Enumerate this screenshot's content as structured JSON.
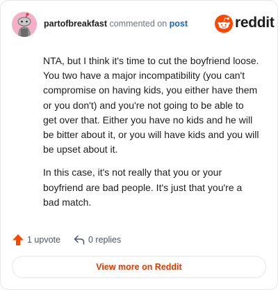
{
  "comment": {
    "author": "partofbreakfast",
    "verb": "commented on",
    "post_link": "post",
    "paragraphs": [
      "NTA, but I think it's time to cut the boyfriend loose. You two have a major incompatibility (you can't compromise on having kids, you either have them or you don't) and you're not going to be able to get over that. Either you have no kids and he will be bitter about it, or you will have kids and you will be upset about it.",
      "In this case, it's not really that you or your boyfriend are bad people. It's just that you're a bad match."
    ]
  },
  "brand": {
    "name": "reddit",
    "icon": "reddit-logo-icon",
    "accent": "#ff4500"
  },
  "footer": {
    "upvote_label": "1 upvote",
    "upvote_icon": "upvote-arrow-icon",
    "replies_label": "0 replies",
    "replies_icon": "reply-arrow-icon",
    "view_more_label": "View more on Reddit"
  },
  "colors": {
    "link": "#1466c2",
    "view_more": "#d93a00",
    "upvote": "#ff4500",
    "avatar_bg": "#f3b0c7"
  }
}
